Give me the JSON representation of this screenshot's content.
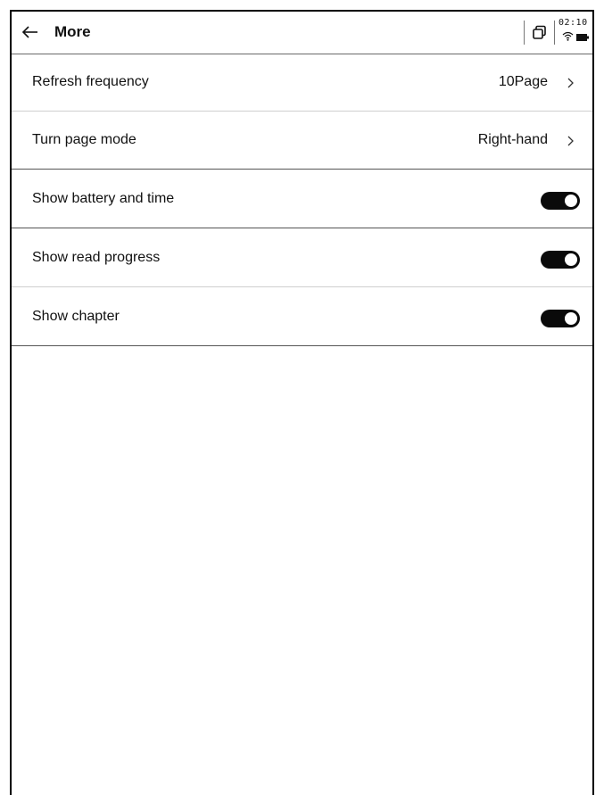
{
  "header": {
    "title": "More",
    "back_icon": "arrow-left-icon",
    "window_icon": "overlapping-windows-icon"
  },
  "status": {
    "time": "02:10",
    "wifi_icon": "wifi-icon",
    "battery_icon": "battery-icon"
  },
  "settings": {
    "refresh_frequency": {
      "label": "Refresh frequency",
      "value": "10Page"
    },
    "turn_page_mode": {
      "label": "Turn page mode",
      "value": "Right-hand"
    },
    "show_battery_and_time": {
      "label": "Show battery and time",
      "on": true
    },
    "show_read_progress": {
      "label": "Show read progress",
      "on": true
    },
    "show_chapter": {
      "label": "Show chapter",
      "on": true
    }
  }
}
